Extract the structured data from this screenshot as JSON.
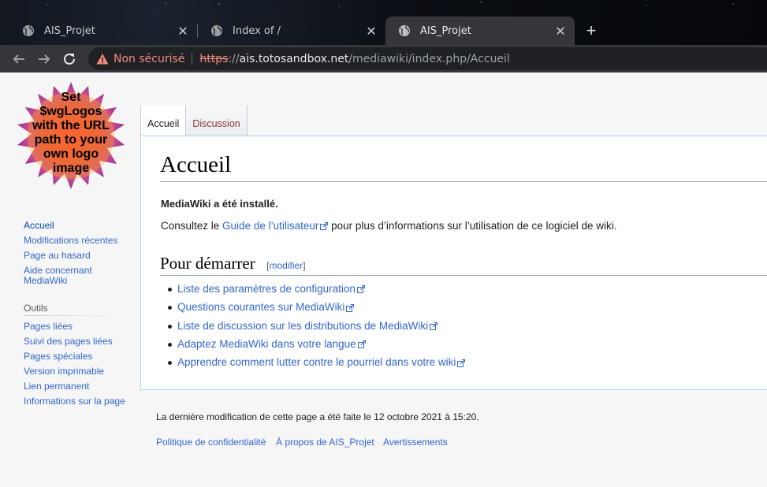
{
  "browser": {
    "tabs": [
      {
        "title": "AIS_Projet",
        "active": false
      },
      {
        "title": "Index of /",
        "active": false
      },
      {
        "title": "AIS_Projet",
        "active": true
      }
    ],
    "address": {
      "security_label": "Non sécurisé",
      "scheme": "https",
      "separator": "://",
      "host": "ais.totosandbox.net",
      "path": "/mediawiki/index.php/Accueil"
    }
  },
  "logo": {
    "lines": [
      "Set",
      "$wgLogos",
      "with the URL",
      "path to your",
      "own logo",
      "image"
    ]
  },
  "page_tabs": {
    "article": "Accueil",
    "discussion": "Discussion"
  },
  "sidebar": {
    "navigation": [
      "Accueil",
      "Modifications récentes",
      "Page au hasard",
      "Aide concernant",
      "MediaWiki"
    ],
    "tools_heading": "Outils",
    "tools": [
      "Pages liées",
      "Suivi des pages liées",
      "Pages spéciales",
      "Version imprimable",
      "Lien permanent",
      "Informations sur la page"
    ]
  },
  "article": {
    "heading": "Accueil",
    "installed": "MediaWiki a été installé.",
    "consult_prefix": "Consultez le ",
    "consult_link": "Guide de l’utilisateur",
    "consult_suffix": " pour plus d’informations sur l’utilisation de ce logiciel de wiki.",
    "section_heading": "Pour démarrer",
    "edit_open": "[",
    "edit_label": "modifier",
    "edit_close": "]",
    "links": [
      "Liste des paramètres de configuration",
      "Questions courantes sur MediaWiki",
      "Liste de discussion sur les distributions de MediaWiki",
      "Adaptez MediaWiki dans votre langue",
      "Apprendre comment lutter contre le pourriel dans votre wiki"
    ]
  },
  "footer": {
    "last_modified": "La dernière modification de cette page a été faite le 12 octobre 2021 à 15:20.",
    "links": [
      "Politique de confidentialité",
      "À propos de AIS_Projet",
      "Avertissements"
    ]
  },
  "colors": {
    "link": "#3366cc",
    "insecure": "#f28b82",
    "chrome_toolbar": "#35363a"
  }
}
